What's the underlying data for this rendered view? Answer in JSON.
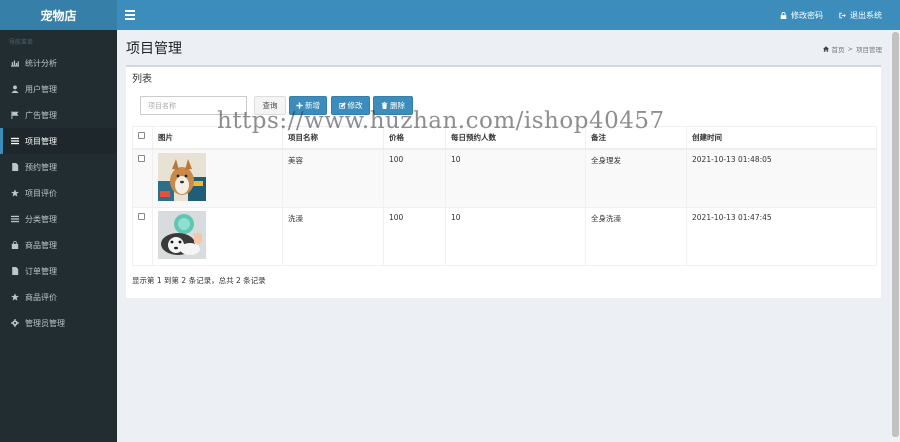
{
  "app": {
    "brand": "宠物店"
  },
  "sidebar": {
    "header": "导航菜单",
    "items": [
      {
        "label": "统计分析",
        "icon": "bar-chart-icon"
      },
      {
        "label": "用户管理",
        "icon": "user-icon"
      },
      {
        "label": "广告管理",
        "icon": "flag-icon"
      },
      {
        "label": "项目管理",
        "icon": "list-icon",
        "active": true
      },
      {
        "label": "预约管理",
        "icon": "file-icon"
      },
      {
        "label": "项目评价",
        "icon": "star-icon"
      },
      {
        "label": "分类管理",
        "icon": "list-icon"
      },
      {
        "label": "商品管理",
        "icon": "shopping-bag-icon"
      },
      {
        "label": "订单管理",
        "icon": "file-icon"
      },
      {
        "label": "商品评价",
        "icon": "star-icon"
      },
      {
        "label": "管理员管理",
        "icon": "gear-icon"
      }
    ]
  },
  "header": {
    "change_password": "修改密码",
    "logout": "退出系统"
  },
  "page": {
    "title": "项目管理",
    "breadcrumb_home": "首页",
    "breadcrumb_sep": ">",
    "breadcrumb_current": "项目管理"
  },
  "list": {
    "title": "列表",
    "search_placeholder": "项目名称",
    "search_button": "查询",
    "add_button": "新增",
    "edit_button": "修改",
    "delete_button": "删除",
    "columns": [
      "图片",
      "项目名称",
      "价格",
      "每日预约人数",
      "备注",
      "创建时间"
    ],
    "rows": [
      {
        "name": "美容",
        "price": "100",
        "daily": "10",
        "note": "全身理发",
        "created": "2021-10-13 01:48:05"
      },
      {
        "name": "洗澡",
        "price": "100",
        "daily": "10",
        "note": "全身洗澡",
        "created": "2021-10-13 01:47:45"
      }
    ],
    "pagination": "显示第 1 到第 2 条记录，总共 2 条记录"
  },
  "watermark": "https://www.huzhan.com/ishop40457",
  "colors": {
    "header": "#3c8dbc",
    "brand": "#367fa9",
    "sidebar": "#222d32",
    "background": "#ecf0f5"
  }
}
